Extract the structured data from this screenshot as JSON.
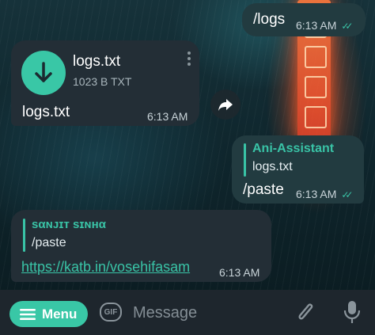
{
  "messages": {
    "sent_logs": {
      "text": "/logs",
      "time": "6:13 AM",
      "checks": "✓✓"
    },
    "file": {
      "name": "logs.txt",
      "size": "1023 B TXT",
      "caption": "logs.txt",
      "time": "6:13 AM"
    },
    "sent_paste": {
      "reply_to_name": "Ani-Assistant",
      "reply_to_text": "logs.txt",
      "text": "/paste",
      "time": "6:13 AM",
      "checks": "✓✓"
    },
    "reply": {
      "reply_to_name": "sαɴᴊɪᴛ sɪɴʜα",
      "reply_to_text": "/paste",
      "link": "https://katb.in/vosehifasam",
      "time": "6:13 AM"
    }
  },
  "input_bar": {
    "menu_label": "Menu",
    "gif_label": "GIF",
    "placeholder": "Message"
  },
  "colors": {
    "accent": "#39c7a6",
    "bubble": "#232e36",
    "link": "#39c3a6"
  },
  "icons": [
    "download-icon",
    "more-vert-icon",
    "forward-icon",
    "menu-icon",
    "gif-icon",
    "attach-icon",
    "microphone-icon"
  ]
}
